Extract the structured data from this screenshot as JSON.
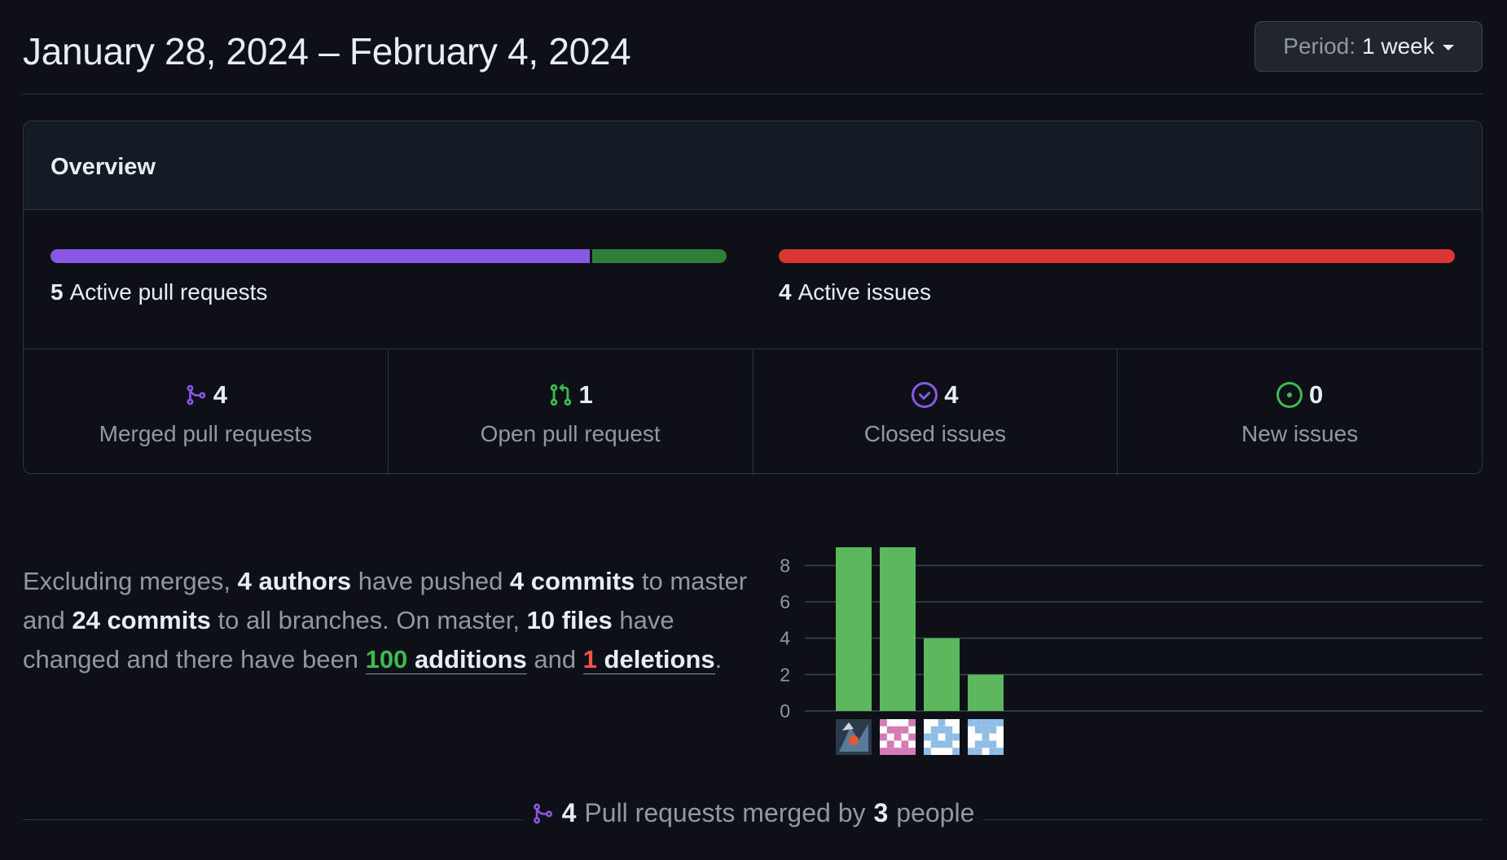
{
  "header": {
    "date_range": "January 28, 2024 – February 4, 2024",
    "period_label": "Period:",
    "period_value": "1 week"
  },
  "overview": {
    "title": "Overview",
    "pull_requests": {
      "count": "5",
      "label": "Active pull requests",
      "merged_fraction": 0.8,
      "open_fraction": 0.2
    },
    "issues": {
      "count": "4",
      "label": "Active issues",
      "closed_fraction": 1.0
    },
    "stats": [
      {
        "icon": "merged-pr-icon",
        "value": "4",
        "label": "Merged pull requests"
      },
      {
        "icon": "open-pr-icon",
        "value": "1",
        "label": "Open pull request"
      },
      {
        "icon": "closed-issue-icon",
        "value": "4",
        "label": "Closed issues"
      },
      {
        "icon": "new-issue-icon",
        "value": "0",
        "label": "New issues"
      }
    ]
  },
  "summary": {
    "t1": "Excluding merges, ",
    "authors": "4 authors",
    "t2": " have pushed ",
    "commits_master": "4 commits",
    "t3": " to master and ",
    "commits_all": "24 commits",
    "t4": " to all branches. On master, ",
    "files": "10 files",
    "t5": " have changed and there have been ",
    "additions_num": "100",
    "additions_word": "additions",
    "t6": " and ",
    "deletions_num": "1",
    "deletions_word": "deletions",
    "t7": "."
  },
  "chart_data": {
    "type": "bar",
    "categories": [
      "author-1",
      "author-2",
      "author-3",
      "author-4"
    ],
    "values": [
      9,
      9,
      4,
      2
    ],
    "yticks": [
      0,
      2,
      4,
      6,
      8
    ],
    "ylim": [
      0,
      9
    ],
    "grid": true
  },
  "footer": {
    "pr_count": "4",
    "t1": "Pull requests merged by",
    "people_count": "3",
    "t2": "people"
  },
  "colors": {
    "merged": "#8957e5",
    "open": "#3fb950",
    "open_bar": "#2f7d3a",
    "issue_bar": "#da3633",
    "commit_bar": "#5cb85c"
  }
}
